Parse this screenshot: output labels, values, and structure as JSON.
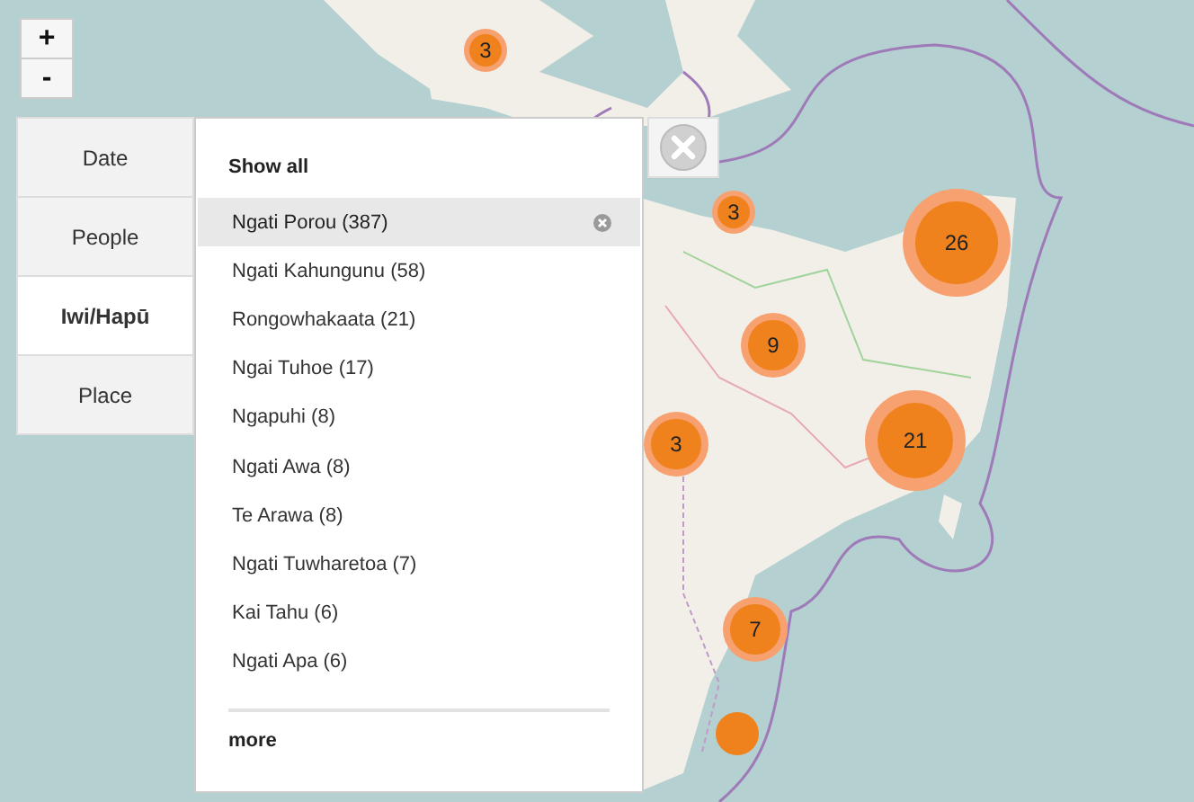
{
  "zoom_controls": [
    "+",
    "-"
  ],
  "tabs": [
    {
      "label": "Date",
      "selected": false
    },
    {
      "label": "People",
      "selected": false
    },
    {
      "label": "Iwi/Hapū",
      "selected": true
    },
    {
      "label": "Place",
      "selected": false
    }
  ],
  "filter": {
    "show_all": "Show all",
    "items": [
      {
        "label": "Ngati Porou (387)",
        "selected": true
      },
      {
        "label": "Ngati Kahungunu (58)",
        "selected": false
      },
      {
        "label": "Rongowhakaata (21)",
        "selected": false
      },
      {
        "label": "Ngai Tuhoe (17)",
        "selected": false
      },
      {
        "label": "Ngapuhi (8)",
        "selected": false
      },
      {
        "label": "Ngati Awa (8)",
        "selected": false
      },
      {
        "label": "Te Arawa (8)",
        "selected": false
      },
      {
        "label": "Ngati Tuwharetoa (7)",
        "selected": false
      },
      {
        "label": "Kai Tahu (6)",
        "selected": false
      },
      {
        "label": "Ngati Apa (6)",
        "selected": false
      }
    ],
    "more": "more"
  },
  "clusters": [
    {
      "kind": "cluster",
      "count": "3"
    },
    {
      "kind": "cluster",
      "count": "3"
    },
    {
      "kind": "cluster",
      "count": "26"
    },
    {
      "kind": "cluster",
      "count": "9"
    },
    {
      "kind": "cluster",
      "count": "3"
    },
    {
      "kind": "cluster",
      "count": "21"
    },
    {
      "kind": "cluster",
      "count": "7"
    },
    {
      "kind": "point"
    }
  ]
}
